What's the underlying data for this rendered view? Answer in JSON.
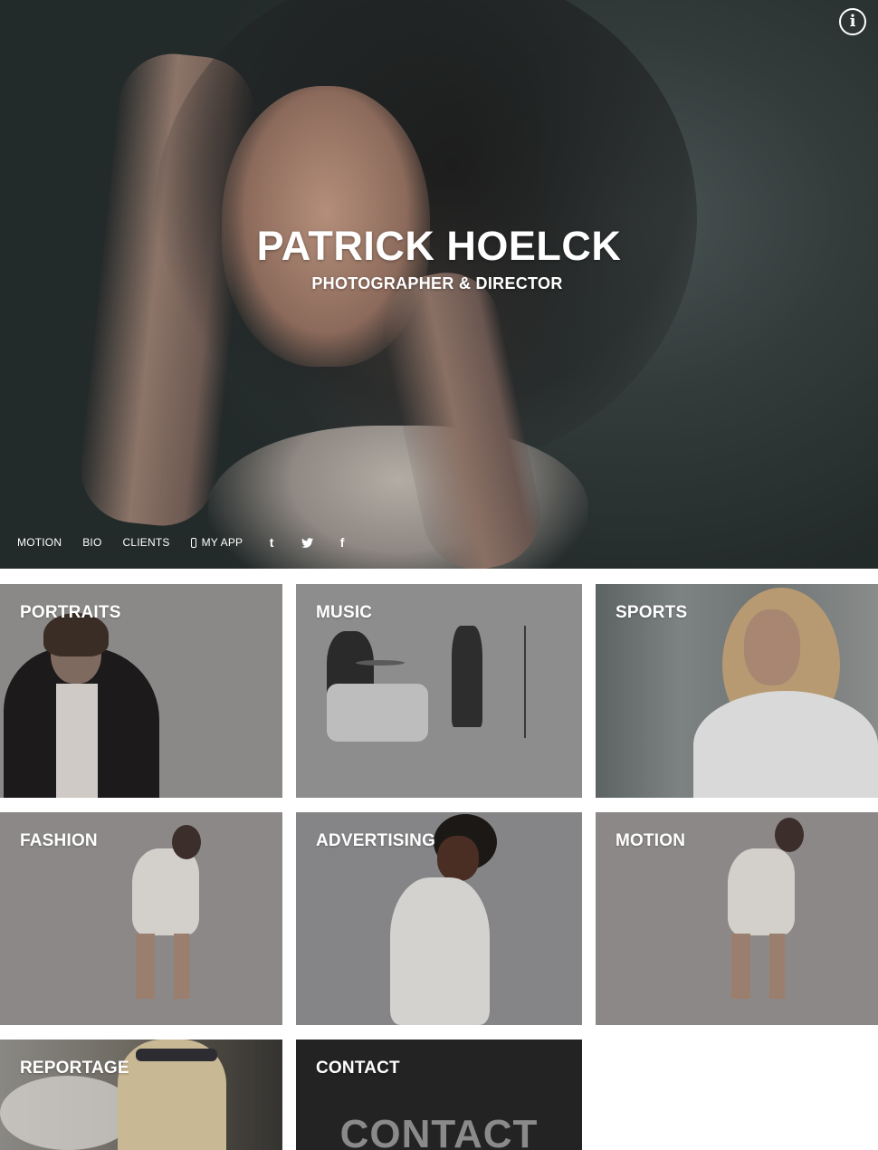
{
  "hero": {
    "title": "PATRICK HOELCK",
    "subtitle": "PHOTOGRAPHER & DIRECTOR",
    "info_icon": "info-icon"
  },
  "nav": {
    "items": [
      {
        "label": "MOTION"
      },
      {
        "label": "BIO"
      },
      {
        "label": "CLIENTS"
      },
      {
        "label": "MY APP",
        "icon": "mobile-phone-icon"
      }
    ],
    "social": [
      {
        "icon": "tumblr-icon",
        "glyph": "t"
      },
      {
        "icon": "twitter-icon"
      },
      {
        "icon": "facebook-icon",
        "glyph": "f"
      }
    ]
  },
  "gallery": {
    "tiles": [
      {
        "label": "PORTRAITS"
      },
      {
        "label": "MUSIC"
      },
      {
        "label": "SPORTS"
      },
      {
        "label": "FASHION"
      },
      {
        "label": "ADVERTISING"
      },
      {
        "label": "MOTION"
      },
      {
        "label": "REPORTAGE"
      },
      {
        "label": "CONTACT",
        "image_text": "CONTACT"
      }
    ]
  },
  "colors": {
    "hero_bg": "#2c3434",
    "tile_overlay": "#8e8d8c",
    "contact_bg": "#232323",
    "text": "#ffffff"
  }
}
